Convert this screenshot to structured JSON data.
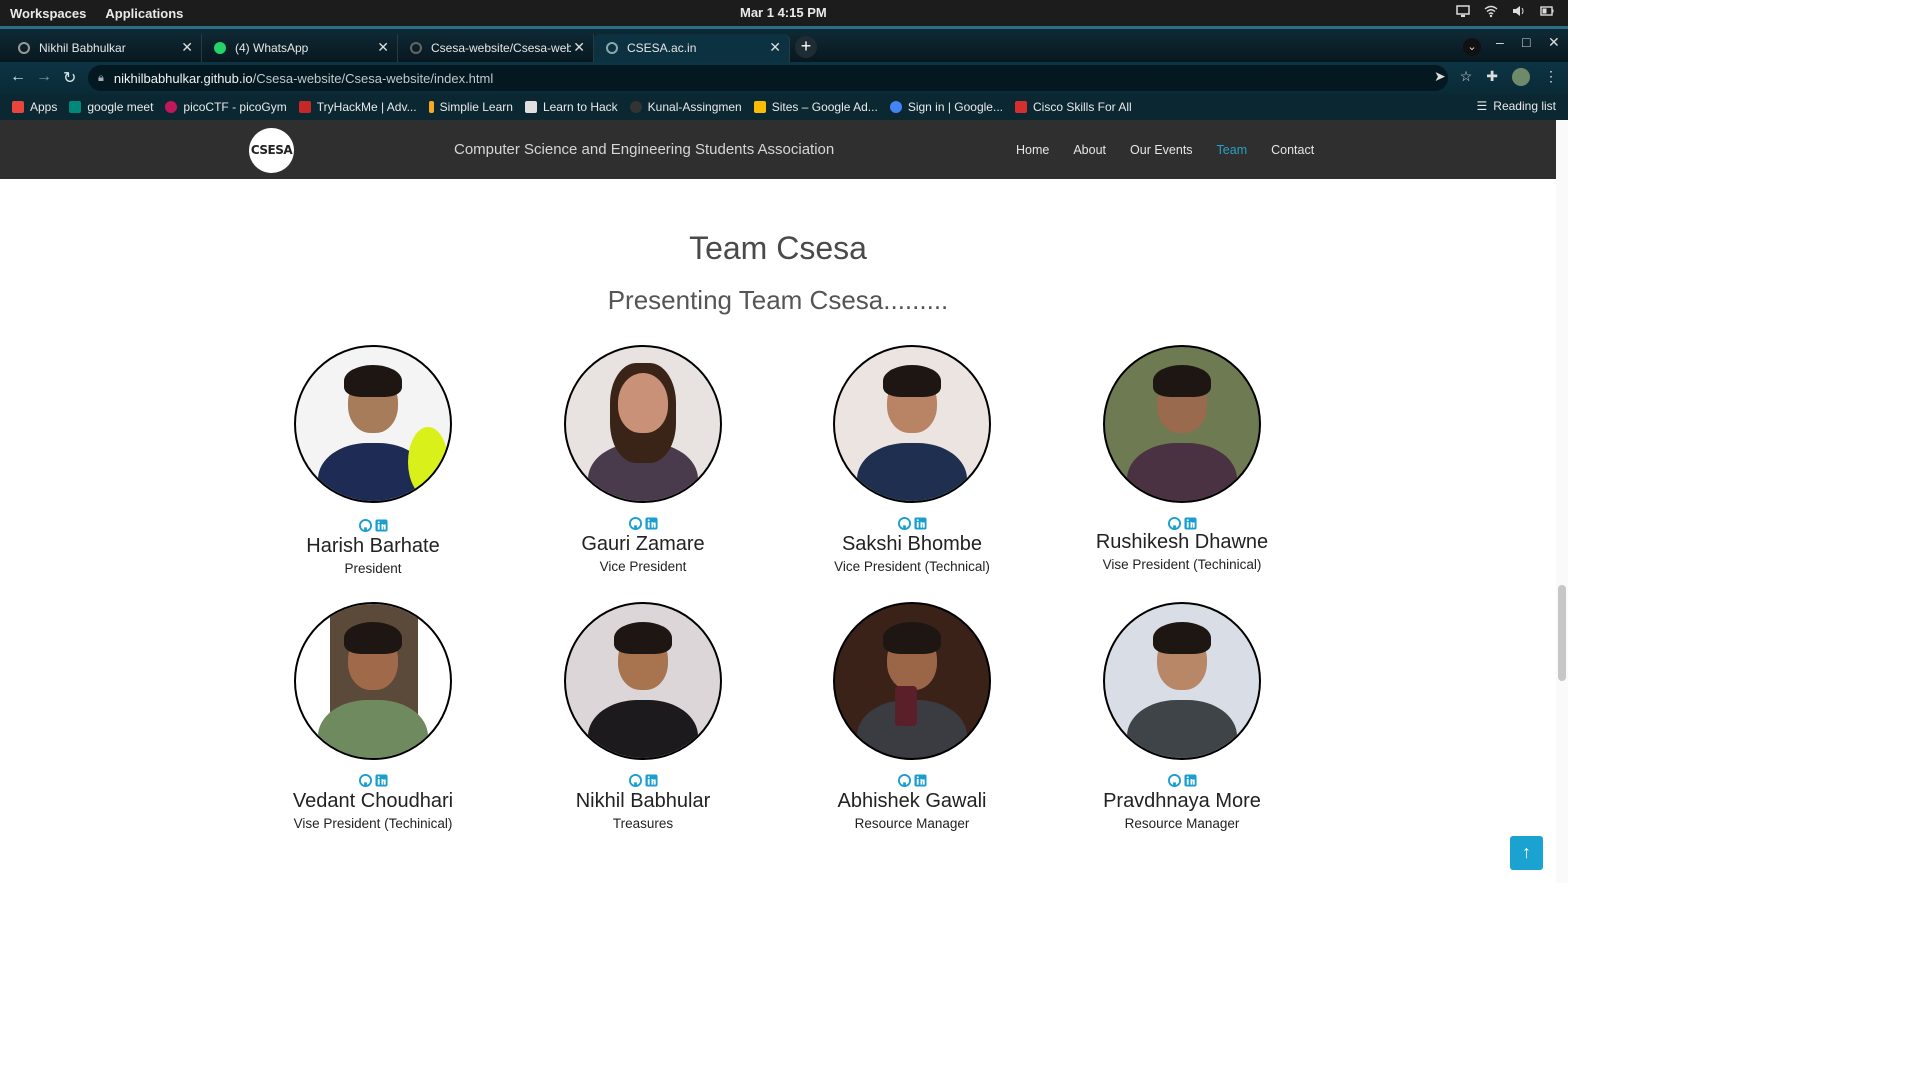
{
  "os": {
    "workspaces": "Workspaces",
    "applications": "Applications",
    "clock": "Mar 1   4:15 PM"
  },
  "browser": {
    "tabs": [
      {
        "label": "Nikhil Babhulkar"
      },
      {
        "label": "(4) WhatsApp"
      },
      {
        "label": "Csesa-website/Csesa-website"
      },
      {
        "label": "CSESA.ac.in"
      }
    ],
    "url_host": "nikhilbabhulkar.github.io",
    "url_path": "/Csesa-website/Csesa-website/index.html",
    "bookmarks": [
      {
        "label": "Apps",
        "color": "#e8453c"
      },
      {
        "label": "google meet",
        "color": "#00897b"
      },
      {
        "label": "picoCTF - picoGym",
        "color": "#c2185b"
      },
      {
        "label": "TryHackMe | Adv...",
        "color": "#c62828"
      },
      {
        "label": "Simplie Learn",
        "color": "#f9a825"
      },
      {
        "label": "Learn to Hack",
        "color": "#e0e0e0"
      },
      {
        "label": "Kunal-Assingmen",
        "color": "#333333"
      },
      {
        "label": "Sites – Google Ad...",
        "color": "#fbbc04"
      },
      {
        "label": "Sign in | Google...",
        "color": "#4285f4"
      },
      {
        "label": "Cisco Skills For All",
        "color": "#d32f2f"
      }
    ],
    "reading_list": "Reading list"
  },
  "site": {
    "logo_text": "CSESA",
    "title": "Computer Science and Engineering Students Association",
    "menu": [
      "Home",
      "About",
      "Our Events",
      "Team",
      "Contact"
    ],
    "accent": "#2aa0c6"
  },
  "team": {
    "heading": "Team Csesa",
    "subheading": "Presenting Team Csesa.........",
    "members": [
      {
        "name": "Harish Barhate",
        "role": "President"
      },
      {
        "name": "Gauri Zamare",
        "role": "Vice President"
      },
      {
        "name": "Sakshi Bhombe",
        "role": "Vice President (Technical)"
      },
      {
        "name": "Rushikesh Dhawne",
        "role": "Vise President (Techinical)"
      },
      {
        "name": "Vedant Choudhari",
        "role": "Vise President (Techinical)"
      },
      {
        "name": "Nikhil Babhular",
        "role": "Treasures"
      },
      {
        "name": "Abhishek Gawali",
        "role": "Resource Manager"
      },
      {
        "name": "Pravdhnaya More",
        "role": "Resource Manager"
      }
    ]
  },
  "scroll_top": "↑"
}
